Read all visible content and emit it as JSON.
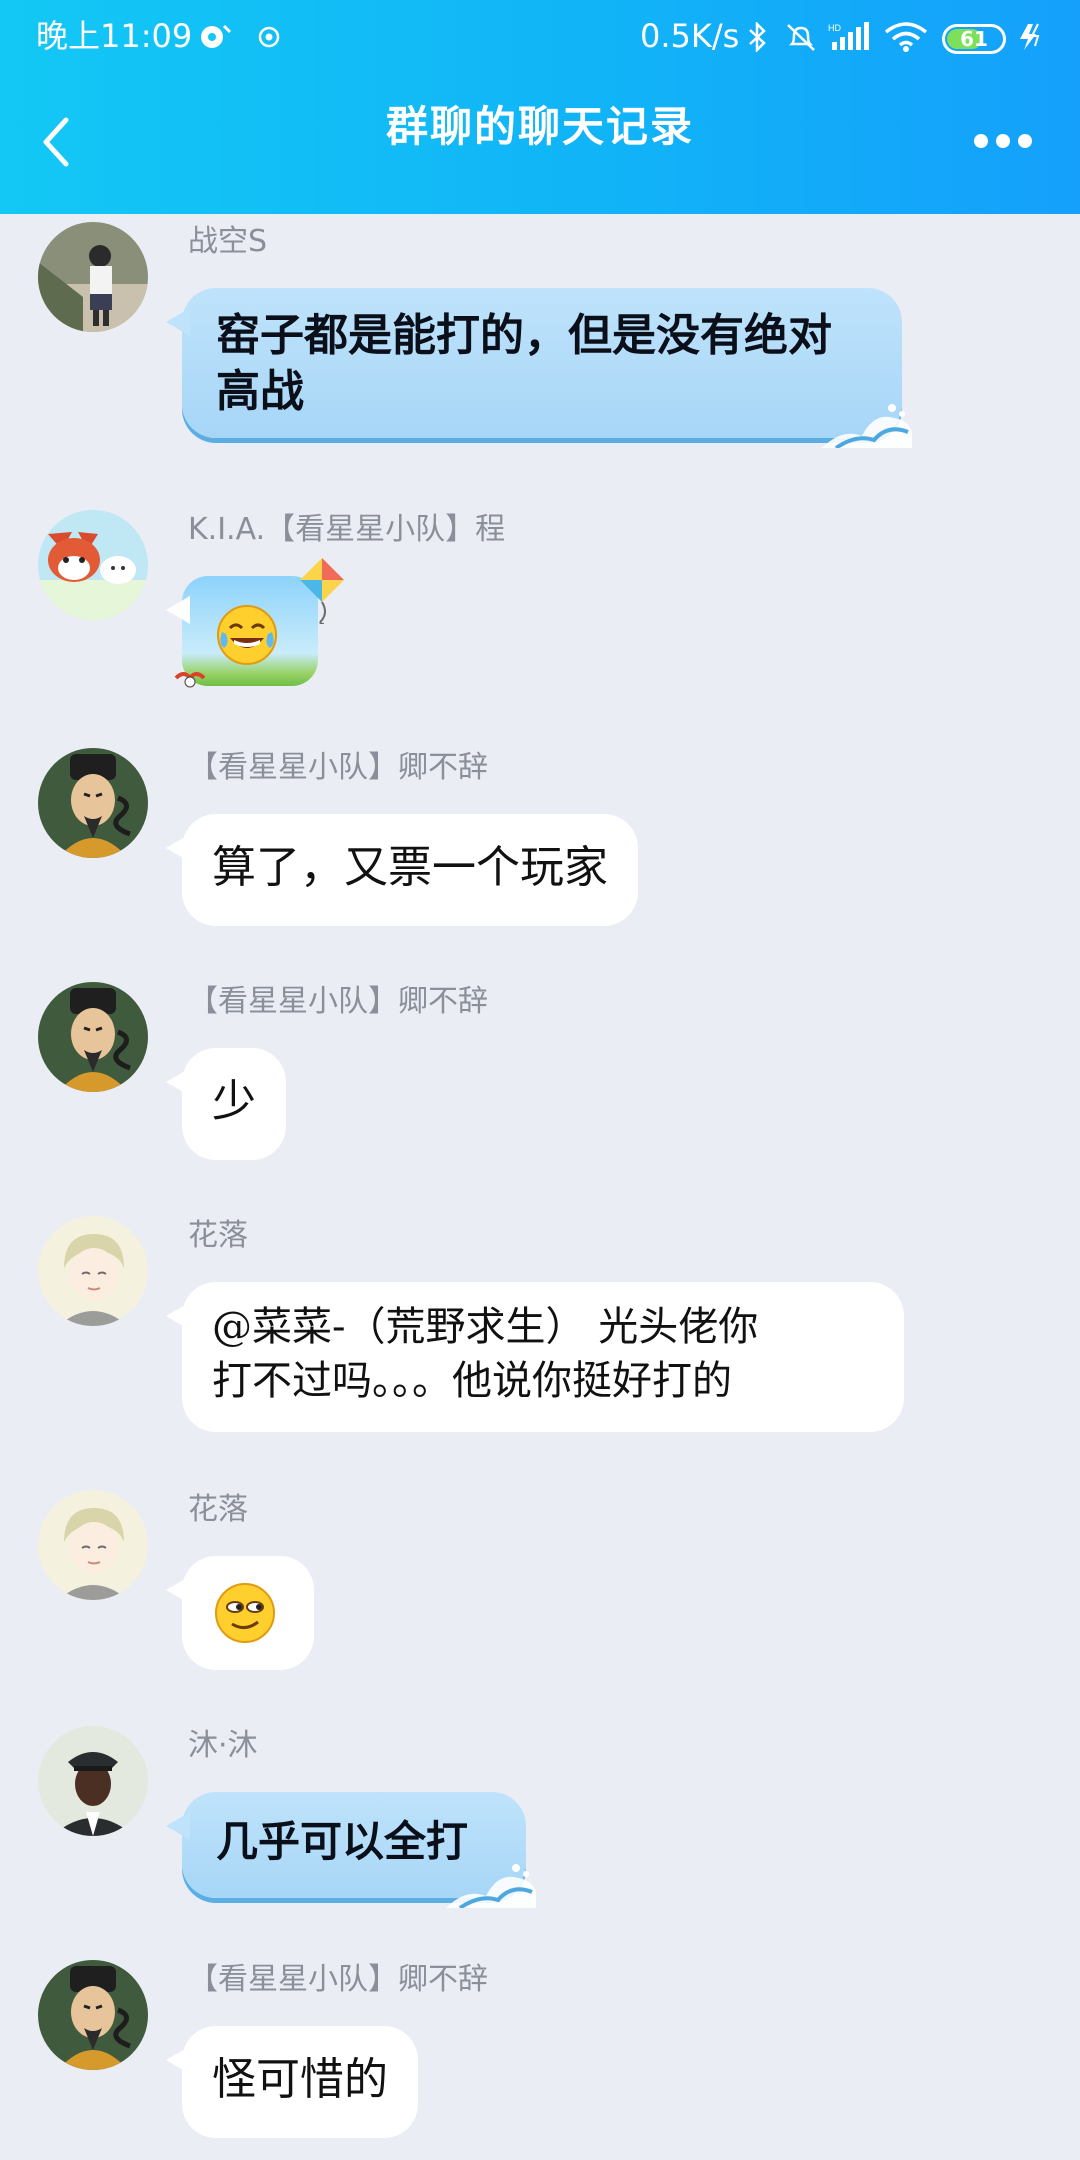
{
  "status_bar": {
    "time": "晚上11:09",
    "net_speed": "0.5K/s",
    "battery": "61",
    "battery_level": 0.61
  },
  "header": {
    "title": "群聊的聊天记录"
  },
  "colors": {
    "header_start": "#13c8f5",
    "header_end": "#14a0fb",
    "background": "#eaedf4",
    "bubble": "#ffffff",
    "bubble_blue": "#bfe3fb",
    "nickname": "#8a8f99"
  },
  "messages": [
    {
      "nickname": "战空S",
      "lines": [
        "窑子都是能打的，但是没有绝对",
        "高战"
      ],
      "bubble_style": "blue-wave",
      "avatar": "child-photo-avatar"
    },
    {
      "nickname": "K.I.A.【看星星小队】程",
      "emoji": "tears-of-joy-emoji",
      "bubble_style": "blue-kite",
      "avatar": "red-panda-cartoon-avatar"
    },
    {
      "nickname": "【看星星小队】卿不辞",
      "text": "算了，又票一个玩家",
      "avatar": "ancient-official-avatar"
    },
    {
      "nickname": "【看星星小队】卿不辞",
      "text": "少",
      "avatar": "ancient-official-avatar"
    },
    {
      "nickname": "花落",
      "lines": [
        "@菜菜-（荒野求生） 光头佬你",
        "打不过吗。。。他说你挺好打的"
      ],
      "avatar": "anime-boy-avatar"
    },
    {
      "nickname": "花落",
      "emoji": "smirk-emoji",
      "avatar": "anime-boy-avatar"
    },
    {
      "nickname": "沐·沐",
      "text": "几乎可以全打",
      "bubble_style": "blue-wave",
      "avatar": "pallbearer-avatar"
    },
    {
      "nickname": "【看星星小队】卿不辞",
      "text": "怪可惜的",
      "avatar": "ancient-official-avatar"
    }
  ]
}
